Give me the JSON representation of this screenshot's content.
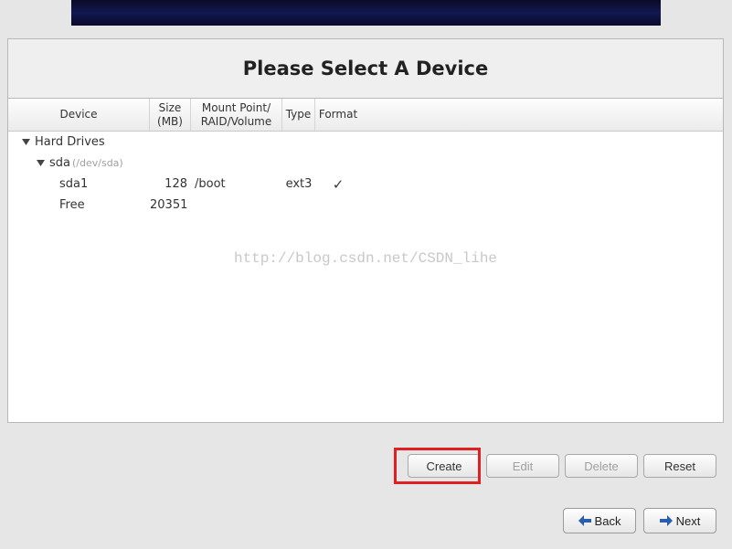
{
  "title": "Please Select A Device",
  "columns": {
    "device": "Device",
    "size": "Size\n(MB)",
    "mount": "Mount Point/\nRAID/Volume",
    "type": "Type",
    "format": "Format"
  },
  "tree": {
    "root": "Hard Drives",
    "disk": "sda",
    "disk_path": "(/dev/sda)",
    "partition": {
      "name": "sda1",
      "size": "128",
      "mount": "/boot",
      "type": "ext3",
      "format": true
    },
    "free": {
      "name": "Free",
      "size": "20351"
    }
  },
  "watermark": "http://blog.csdn.net/CSDN_lihe",
  "buttons": {
    "create": "Create",
    "edit": "Edit",
    "delete": "Delete",
    "reset": "Reset"
  },
  "nav": {
    "back": "Back",
    "next": "Next"
  }
}
